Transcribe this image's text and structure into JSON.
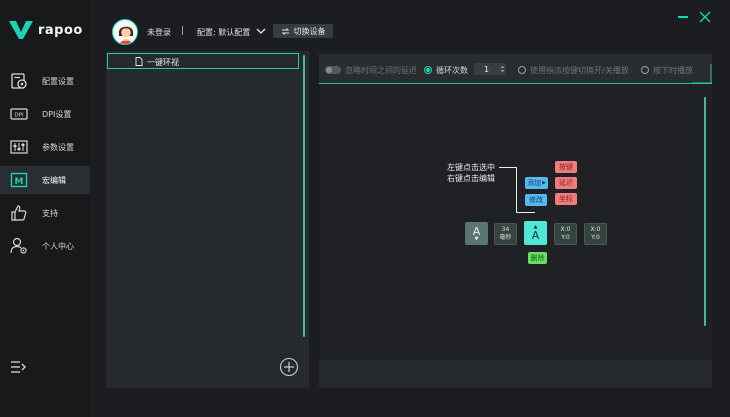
{
  "app": {
    "brand": "rapoo"
  },
  "sidebar": {
    "items": [
      {
        "label": "配置设置",
        "icon": "gear-doc-icon"
      },
      {
        "label": "DPI设置",
        "icon": "dpi-icon"
      },
      {
        "label": "参数设置",
        "icon": "sliders-icon"
      },
      {
        "label": "宏编辑",
        "icon": "macro-icon",
        "active": true
      },
      {
        "label": "支持",
        "icon": "thumbs-up-icon"
      },
      {
        "label": "个人中心",
        "icon": "user-gear-icon"
      }
    ]
  },
  "topbar": {
    "login_status": "未登录",
    "profile_label": "配置: 默认配置",
    "switch_device_label": "切换设备"
  },
  "macro_list": {
    "items": [
      {
        "name": "一键环视"
      }
    ]
  },
  "toolbar": {
    "ignore_delay_label": "忽略时间之间的延迟",
    "loop_count_label": "循环次数",
    "loop_count_value": "1",
    "toggle_by_key_label": "使用指派按键切换开/关播放",
    "play_on_press_label": "按下时播放",
    "selected_mode": "循环次数"
  },
  "help": {
    "line1": "左键点击选中",
    "line2": "右键点击编辑",
    "add_label": "添加",
    "modify_label": "修改",
    "key_label": "按键",
    "delay_label": "延迟",
    "coord_label": "坐标",
    "delete_label": "删除"
  },
  "sample_events": {
    "key_a1": "A",
    "delay_value": "34",
    "delay_unit": "毫秒",
    "key_a2": "A",
    "coord1_x": "X:0",
    "coord1_y": "Y:0",
    "coord2_x": "X:0",
    "coord2_y": "Y:0"
  },
  "colors": {
    "accent": "#1ed2b4",
    "background": "#1b1d20",
    "panel": "#272a2d",
    "red_button": "#f07c7c",
    "blue_button": "#56b9ef",
    "green_button": "#67df63"
  }
}
